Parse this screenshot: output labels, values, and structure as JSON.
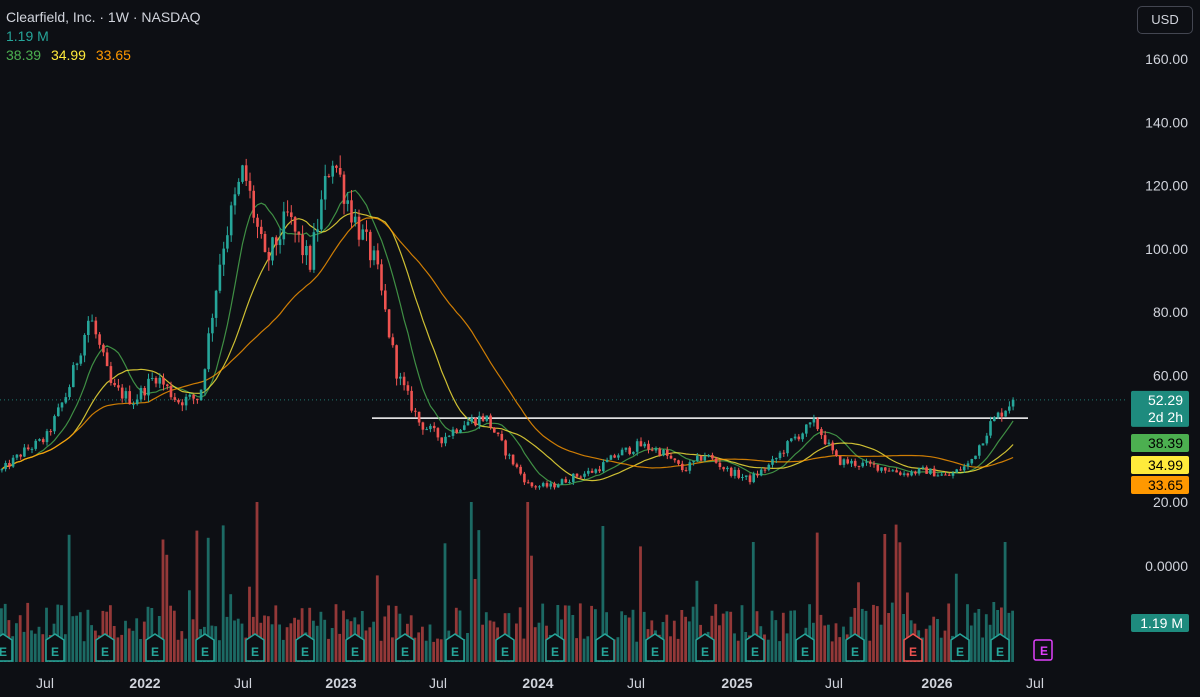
{
  "header": {
    "title": "Clearfield, Inc. · 1W · NASDAQ",
    "volume": "1.19 M",
    "ma_values": [
      "38.39",
      "34.99",
      "33.65"
    ]
  },
  "currency_button": "USD",
  "colors": {
    "background": "#0d0f14",
    "up": "#26a69a",
    "down": "#ef5350",
    "ma1": "#4caf50",
    "ma2": "#ffeb3b",
    "ma3": "#ff9800",
    "resistance_line": "#ffffff"
  },
  "chart_data": {
    "type": "candlestick",
    "title": "Clearfield, Inc. · 1W · NASDAQ",
    "interval": "1W",
    "y_axis": {
      "ticks": [
        "160.00",
        "140.00",
        "120.00",
        "100.00",
        "80.00",
        "60.00",
        "20.00"
      ],
      "ylim": [
        20,
        160
      ]
    },
    "volume_axis_label": "0.0000",
    "x_axis_ticks": [
      "Jul",
      "2022",
      "Jul",
      "2023",
      "Jul",
      "2024",
      "Jul",
      "2025",
      "Jul",
      "2026",
      "Jul"
    ],
    "last_price": {
      "value": "52.29",
      "countdown": "2d 2h",
      "numeric": 52.29
    },
    "ma_labels": [
      "38.39",
      "34.99",
      "33.65"
    ],
    "volume_label": "1.19 M",
    "resistance_level": 46.5,
    "price_path": [
      [
        "2021-04",
        30
      ],
      [
        "2021-07",
        36
      ],
      [
        "2021-10",
        40
      ],
      [
        "2021-12",
        55
      ],
      [
        "2022-01",
        79
      ],
      [
        "2022-02",
        56
      ],
      [
        "2022-03",
        52
      ],
      [
        "2022-04",
        60
      ],
      [
        "2022-05",
        52
      ],
      [
        "2022-06",
        53
      ],
      [
        "2022-07",
        100
      ],
      [
        "2022-08",
        125
      ],
      [
        "2022-09",
        95
      ],
      [
        "2022-10",
        110
      ],
      [
        "2022-11",
        95
      ],
      [
        "2022-12",
        130
      ],
      [
        "2023-01",
        110
      ],
      [
        "2023-02",
        95
      ],
      [
        "2023-03",
        60
      ],
      [
        "2023-04",
        45
      ],
      [
        "2023-05",
        40
      ],
      [
        "2023-06",
        45
      ],
      [
        "2023-07",
        47
      ],
      [
        "2023-09",
        35
      ],
      [
        "2023-10",
        25
      ],
      [
        "2023-12",
        25
      ],
      [
        "2024-02",
        28
      ],
      [
        "2024-04",
        30
      ],
      [
        "2024-05",
        35
      ],
      [
        "2024-07",
        38
      ],
      [
        "2024-09",
        36
      ],
      [
        "2024-11",
        30
      ],
      [
        "2024-12",
        35
      ],
      [
        "2025-02",
        30
      ],
      [
        "2025-03",
        27
      ],
      [
        "2025-05",
        32
      ],
      [
        "2025-07",
        40
      ],
      [
        "2025-08",
        45
      ],
      [
        "2025-09",
        33
      ],
      [
        "2025-10",
        32
      ],
      [
        "2025-11",
        31
      ],
      [
        "2026-01",
        29
      ],
      [
        "2026-03",
        30
      ],
      [
        "2026-04",
        28
      ],
      [
        "2026-05",
        32
      ],
      [
        "2026-05",
        45
      ],
      [
        "2026-06",
        52.29
      ]
    ]
  }
}
